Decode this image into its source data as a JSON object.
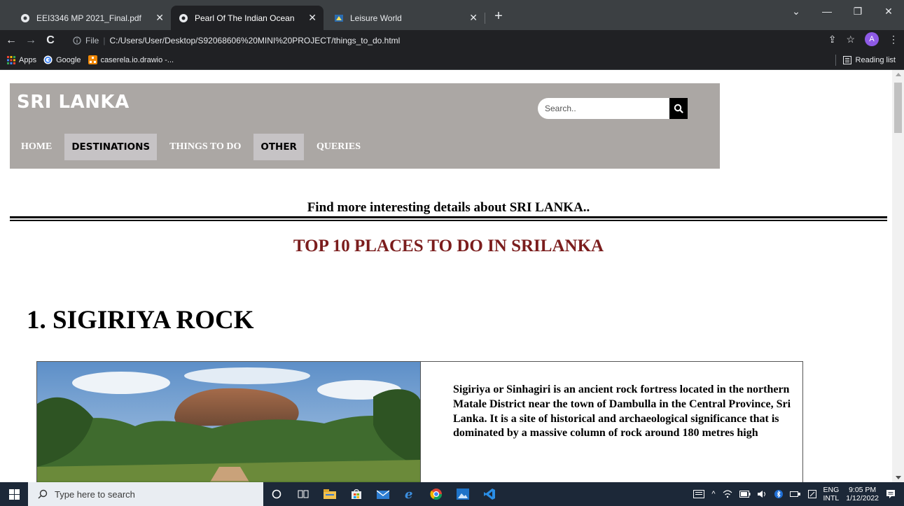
{
  "browser": {
    "tabs": [
      {
        "title": "EEI3346 MP 2021_Final.pdf",
        "active": false
      },
      {
        "title": "Pearl Of The Indian Ocean",
        "active": true
      },
      {
        "title": "Leisure World",
        "active": false
      }
    ],
    "new_tab": "+",
    "address": {
      "scheme_label": "File",
      "url": "C:/Users/User/Desktop/S92068606%20MINI%20PROJECT/things_to_do.html"
    },
    "profile_initial": "A",
    "bookmarks": [
      {
        "label": "Apps"
      },
      {
        "label": "Google"
      },
      {
        "label": "caserela.io.drawio -..."
      }
    ],
    "reading_list": "Reading list"
  },
  "site": {
    "logo": "SRI LANKA",
    "search_placeholder": "Search..",
    "nav": [
      {
        "label": "HOME",
        "boxed": false
      },
      {
        "label": "DESTINATIONS",
        "boxed": true
      },
      {
        "label": "THINGS TO DO",
        "boxed": false
      },
      {
        "label": "OTHER",
        "boxed": true
      },
      {
        "label": "QUERIES",
        "boxed": false
      }
    ],
    "intro": "Find more interesting details about SRI LANKA..",
    "section_title": "TOP 10 PLACES TO DO IN SRILANKA",
    "place": {
      "title": "1. SIGIRIYA ROCK",
      "description": "Sigiriya or Sinhagiri is an ancient rock fortress located in the northern Matale District near the town of Dambulla in the Central Province, Sri Lanka. It is a site of historical and archaeological significance that is dominated by a massive column of rock around 180 metres high"
    }
  },
  "taskbar": {
    "search_placeholder": "Type here to search",
    "lang_top": "ENG",
    "lang_bottom": "INTL",
    "time": "9:05 PM",
    "date": "1/12/2022"
  },
  "colors": {
    "header_bg": "#aba7a4",
    "nav_box_bg": "#c6c3c5",
    "section_title": "#7b1d1d"
  }
}
